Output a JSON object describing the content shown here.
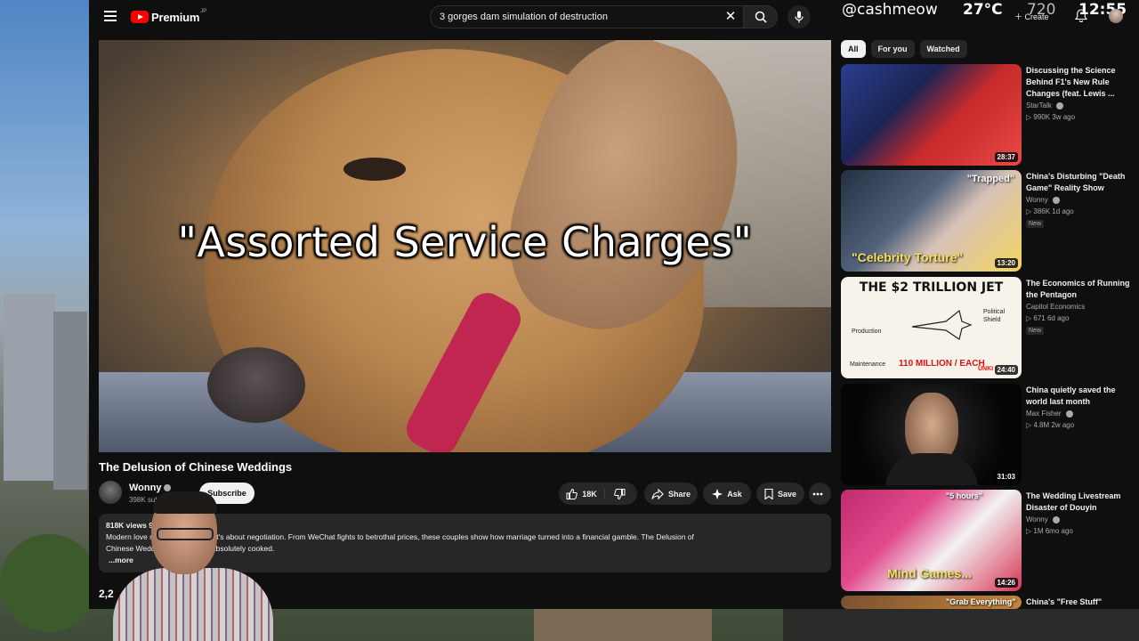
{
  "masthead": {
    "logo_text": "Premium",
    "logo_region": "JP",
    "search_value": "3 gorges dam simulation of destruction"
  },
  "stream_overlay": {
    "handle": "@cashmeow",
    "temperature": "27°C",
    "resolution": "720",
    "create_label": "Create",
    "time": "12:55"
  },
  "player": {
    "caption": "\"Assorted Service Charges\""
  },
  "video": {
    "title": "The Delusion of Chinese Weddings",
    "channel": "Wonny",
    "subscribers": "398K subscri",
    "subscribe_label": "Subscribe",
    "likes": "18K",
    "share_label": "Share",
    "ask_label": "Ask",
    "save_label": "Save",
    "views": "818K views  9",
    "description_line1": "Modern love                          romance anymore, it's about negotiation. From WeChat fights to betrothal prices, these couples show how marriage turned into a financial gamble. The Delusion of",
    "description_line2": "Chinese Wedd                 owry Prices are absolutely cooked.",
    "more_label": "...more",
    "comments_count": "2,2"
  },
  "chips": [
    "All",
    "For you",
    "Watched"
  ],
  "recommendations": [
    {
      "title": "Discussing the Science Behind F1's New Rule Changes (feat. Lewis ...",
      "channel": "StarTalk",
      "meta": "990K  3w ago",
      "duration": "28:37",
      "badge": ""
    },
    {
      "title": "China's Disturbing \"Death Game\" Reality Show",
      "channel": "Wonny",
      "meta": "386K  1d ago",
      "duration": "13:20",
      "badge": "New",
      "thumb_top": "\"Trapped\"",
      "thumb_bottom": "\"Celebrity Torture\""
    },
    {
      "title": "The Economics of Running the Pentagon",
      "channel": "Capitol Economics",
      "meta": "671  6d ago",
      "duration": "24:40",
      "badge": "New",
      "thumb_title": "THE $2 TRILLION JET",
      "thumb_price": "110 MILLION / EACH",
      "thumb_label_a": "Production",
      "thumb_label_b": "Maintenance",
      "thumb_label_c": "Political Shield",
      "thumb_label_d": "UNKI"
    },
    {
      "title": "China quietly saved the world last month",
      "channel": "Max Fisher",
      "meta": "4.8M  2w ago",
      "duration": "31:03",
      "badge": ""
    },
    {
      "title": "The Wedding Livestream Disaster of Douyin",
      "channel": "Wonny",
      "meta": "1M  6mo ago",
      "duration": "14:26",
      "badge": "",
      "thumb_top": "\"5 hours\"",
      "thumb_bottom": "Mind Games..."
    },
    {
      "title": "China's \"Free Stuff\"",
      "channel": "",
      "meta": "",
      "duration": "",
      "badge": "",
      "thumb_top": "\"Grab Everything\""
    }
  ],
  "colors": {
    "background": "#0f0f0f",
    "surface": "#272727",
    "brand_red": "#ff0000",
    "text_primary": "#f1f1f1",
    "text_secondary": "#aaaaaa"
  }
}
